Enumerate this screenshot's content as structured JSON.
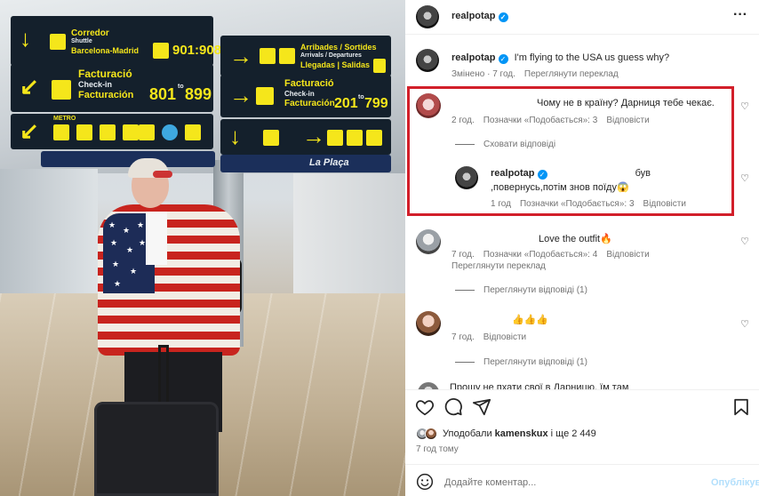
{
  "photo_signs": {
    "corredor": "Corredor",
    "shuttle": "Shuttle",
    "barcelona_madrid": "Barcelona-Madrid",
    "hours": "901:908",
    "arribades": "Arribades / Sortides",
    "arrivals": "Arrivals / Departures",
    "llegadas": "Llegadas | Salidas",
    "facturacio1": "Facturació",
    "checkin1": "Check-in",
    "facturacion1": "Facturación",
    "range1_a": "801",
    "range1_to": "to",
    "range1_b": "899",
    "facturacio2": "Facturació",
    "checkin2": "Check-in",
    "facturacion2": "Facturación",
    "range2_a": "201",
    "range2_to": "to",
    "range2_b": "799",
    "metro": "METRO",
    "la_placa": "La Plaça"
  },
  "header": {
    "username": "realpotap",
    "more_icon": "more-horizontal-icon"
  },
  "caption": {
    "username": "realpotap",
    "text": "I'm flying to the USA us guess why?",
    "edited": "Змінено · 7 год.",
    "translate": "Переглянути переклад"
  },
  "comments": [
    {
      "text": "Чому не в країну? Дарниця тебе чекає.",
      "time": "2 год.",
      "likes": "Позначки «Подобається»: 3",
      "reply": "Відповісти",
      "hide_replies": "Сховати відповіді",
      "replies": [
        {
          "username": "realpotap",
          "text_line1": "був",
          "text_line2": ",повернусь,потім знов поїду😱",
          "time": "1 год",
          "likes": "Позначки «Подобається»: 3",
          "reply": "Відповісти"
        }
      ]
    },
    {
      "text": "Love the outfit🔥",
      "time": "7 год.",
      "likes": "Позначки «Подобається»: 4",
      "reply": "Відповісти",
      "translate": "Переглянути переклад",
      "view_replies": "Переглянути відповіді (1)"
    },
    {
      "text": "👍👍👍",
      "time": "7 год.",
      "reply": "Відповісти",
      "view_replies": "Переглянути відповіді (1)"
    }
  ],
  "cut_comment": "Прошу не пхати свої  в Дарницю, їм там",
  "actions": {
    "like_icon": "heart-icon",
    "comment_icon": "comment-icon",
    "share_icon": "send-icon",
    "save_icon": "bookmark-icon"
  },
  "likes_summary": {
    "prefix": "Уподобали",
    "user": "kamenskux",
    "suffix": "і ще 2 449"
  },
  "post_time": "7 год тому",
  "composer": {
    "placeholder": "Додайте коментар...",
    "post_label": "Опублікувати",
    "emoji_icon": "emoji-icon"
  },
  "colors": {
    "highlight_border": "#d21f2a",
    "verified": "#0095f6",
    "sign_yellow": "#f5e61b",
    "sign_bg": "#14202c"
  }
}
